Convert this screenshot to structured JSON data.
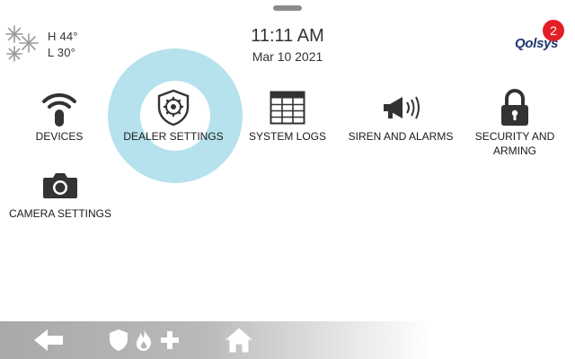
{
  "weather": {
    "high": "H 44°",
    "low": "L 30°",
    "icon": "snowflake-icon"
  },
  "clock": {
    "time": "11:11 AM",
    "date": "Mar 10 2021"
  },
  "logo": {
    "text": "Qolsys",
    "notification_count": "2",
    "badge_color": "#e41e26"
  },
  "highlight_color": "#b5e2ec",
  "menu": [
    {
      "label": "DEVICES",
      "icon": "wifi-icon"
    },
    {
      "label": "DEALER SETTINGS",
      "icon": "shield-gear-icon"
    },
    {
      "label": "SYSTEM LOGS",
      "icon": "table-icon"
    },
    {
      "label": "SIREN AND ALARMS",
      "icon": "megaphone-icon"
    },
    {
      "label": "SECURITY AND ARMING",
      "icon": "lock-icon"
    },
    {
      "label": "CAMERA SETTINGS",
      "icon": "camera-icon"
    }
  ],
  "bottom_bar": {
    "icons": [
      "back-arrow-icon",
      "shield-icon",
      "fire-icon",
      "plus-icon",
      "home-icon"
    ]
  }
}
